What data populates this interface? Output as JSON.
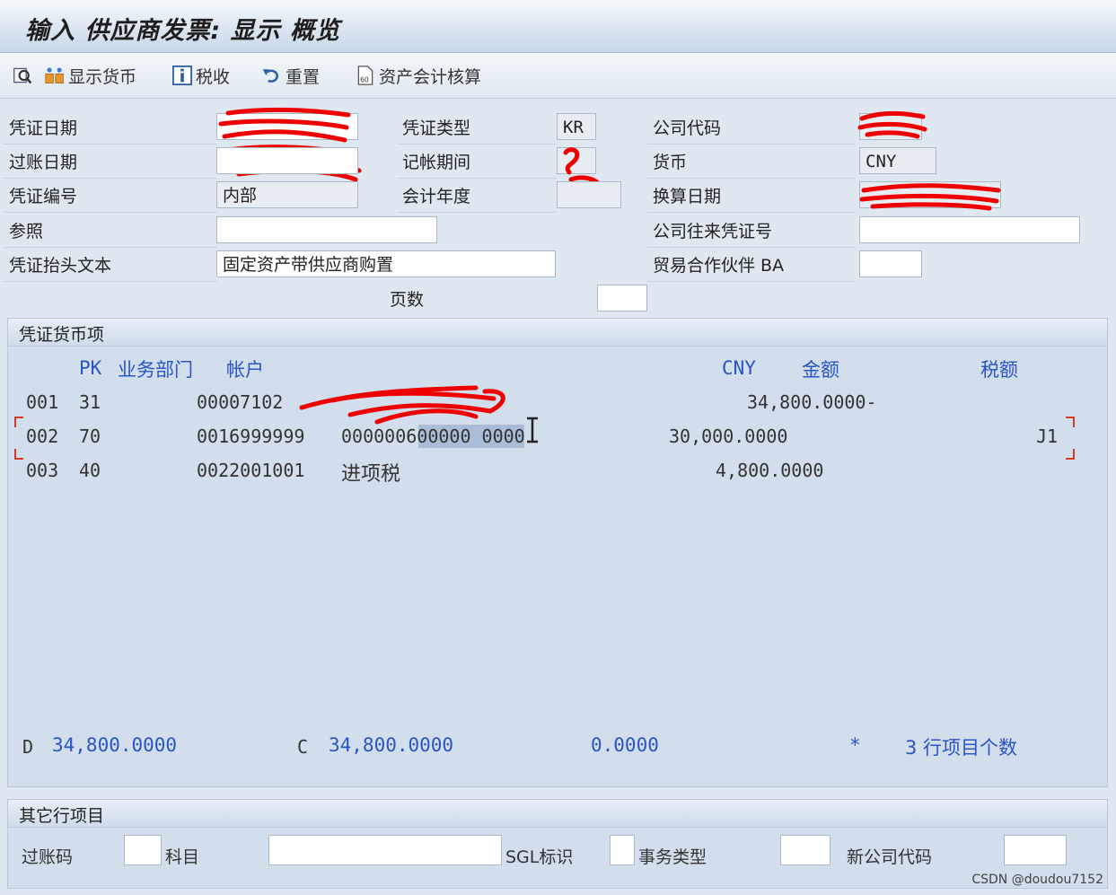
{
  "window": {
    "title": "输入 供应商发票: 显示 概览"
  },
  "toolbar": {
    "display_currency": "显示货币",
    "tax": "税收",
    "reset": "重置",
    "asset_accounting": "资产会计核算"
  },
  "header": {
    "doc_date_label": "凭证日期",
    "post_date_label": "过账日期",
    "doc_number_label": "凭证编号",
    "doc_number_value": "内部",
    "reference_label": "参照",
    "reference_value": "",
    "header_text_label": "凭证抬头文本",
    "header_text_value": "固定资产带供应商购置",
    "doc_type_label": "凭证类型",
    "doc_type_value": "KR",
    "period_label": "记帐期间",
    "fiscal_year_label": "会计年度",
    "pages_label": "页数",
    "pages_value": "",
    "company_code_label": "公司代码",
    "currency_label": "货币",
    "currency_value": "CNY",
    "translation_date_label": "换算日期",
    "cross_cc_label": "公司往来凭证号",
    "cross_cc_value": "",
    "trading_partner_label": "贸易合作伙伴 BA",
    "trading_partner_value": ""
  },
  "items": {
    "group_title": "凭证货币项",
    "columns": {
      "pk": "PK",
      "bus_area": "业务部门",
      "account": "帐户",
      "currency": "CNY",
      "amount": "金额",
      "tax": "税额"
    },
    "rows": [
      {
        "no": "001",
        "pk": "31",
        "account": "00007102",
        "desc": "",
        "amount": "34,800.0000-",
        "tax": ""
      },
      {
        "no": "002",
        "pk": "70",
        "account": "0016999999",
        "desc": "000000600000 0000",
        "amount": "30,000.0000",
        "tax": "J1"
      },
      {
        "no": "003",
        "pk": "40",
        "account": "0022001001",
        "desc": "进项税",
        "amount": "4,800.0000",
        "tax": ""
      }
    ],
    "totals": {
      "d_label": "D",
      "d_value": "34,800.0000",
      "c_label": "C",
      "c_value": "34,800.0000",
      "balance": "0.0000",
      "star": "*",
      "count_text": "3 行项目个数"
    }
  },
  "other_items": {
    "group_title": "其它行项目",
    "posting_key_label": "过账码",
    "account_label": "科目",
    "sgl_label": "SGL标识",
    "trans_type_label": "事务类型",
    "new_cc_label": "新公司代码"
  },
  "watermark": "CSDN @doudou7152"
}
